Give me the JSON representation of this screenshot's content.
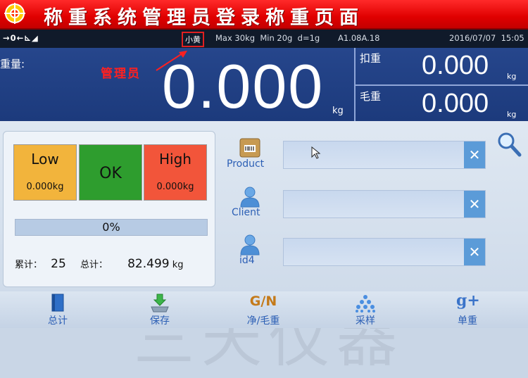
{
  "banner": {
    "title": "称重系统管理员登录称重页面"
  },
  "status": {
    "indicators": "→0←⊾◢",
    "user": "小黄",
    "capacity": "Max 30kg",
    "min": "Min 20g",
    "division": "d=1g",
    "firmware": "A1.08A.18",
    "date": "2016/07/07",
    "time": "15:05"
  },
  "weight": {
    "label": "重量:",
    "role_annotation": "管理员",
    "value": "0.000",
    "unit": "kg",
    "tare_label": "扣重",
    "tare_value": "0.000",
    "tare_unit": "kg",
    "gross_label": "毛重",
    "gross_value": "0.000",
    "gross_unit": "kg"
  },
  "check": {
    "low_label": "Low",
    "low_value": "0.000kg",
    "ok_label": "OK",
    "high_label": "High",
    "high_value": "0.000kg",
    "progress": "0%",
    "count_label": "累计：",
    "count_value": "25",
    "total_label": "总计：",
    "total_value": "82.499",
    "total_unit": "kg"
  },
  "fields": [
    {
      "label": "Product",
      "icon": "product-box-icon",
      "clear": "✕"
    },
    {
      "label": "Client",
      "icon": "user-icon",
      "clear": "✕"
    },
    {
      "label": "id4",
      "icon": "user-icon",
      "clear": "✕"
    }
  ],
  "watermark": "三天仪器",
  "nav": [
    {
      "label": "总计",
      "icon": "book-icon"
    },
    {
      "label": "保存",
      "icon": "save-scale-icon"
    },
    {
      "label": "净/毛重",
      "icon": "gn-icon",
      "glyph": "G/N"
    },
    {
      "label": "采样",
      "icon": "sample-dots-icon"
    },
    {
      "label": "单重",
      "icon": "gplus-icon",
      "glyph": "g+"
    }
  ],
  "colors": {
    "banner": "#e00000",
    "status_bg": "#101a2a",
    "weight_bg": "#1c3a7c",
    "low": "#f2b43c",
    "ok": "#2e9d2e",
    "high": "#f2553a",
    "field": "#c8d8ee",
    "clear_button": "#5b9bd8",
    "nav_label": "#2c5fb5"
  }
}
